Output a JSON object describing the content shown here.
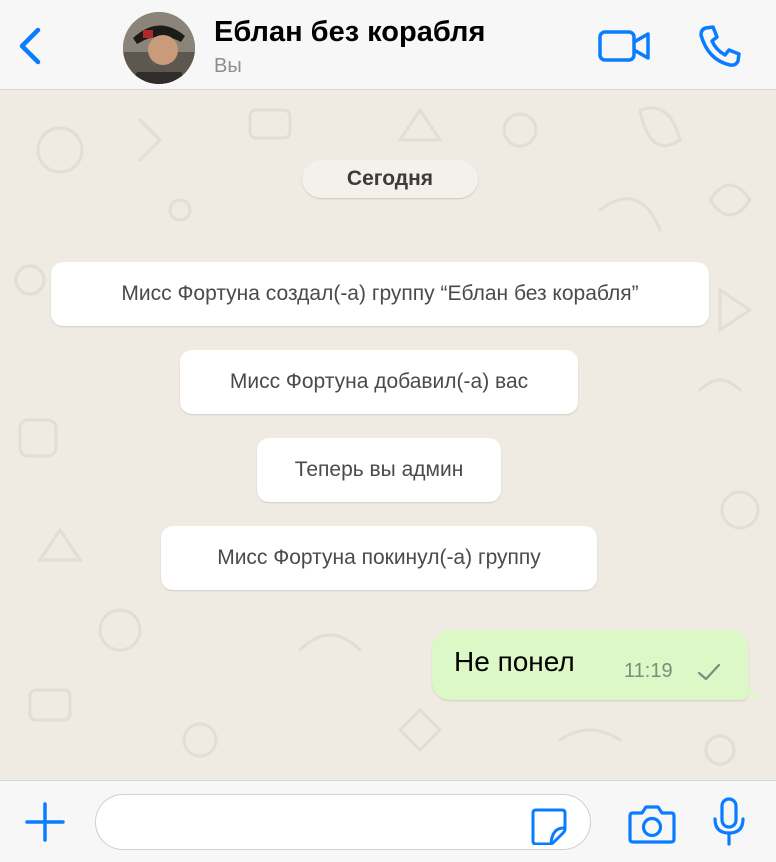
{
  "header": {
    "back_icon": "chevron-left-icon",
    "avatar_icon": "pirate-avatar",
    "title": "Еблан без корабля",
    "subtitle": "Вы",
    "video_icon": "video-camera-icon",
    "call_icon": "phone-icon"
  },
  "chat": {
    "date_label": "Сегодня",
    "system_messages": [
      "Мисс Фортуна создал(-а) группу “Еблан без корабля”",
      "Мисс Фортуна добавил(-а) вас",
      "Теперь вы админ",
      "Мисс Фортуна покинул(-а) группу"
    ],
    "outgoing_message": {
      "text": "Не понел",
      "time": "11:19",
      "status_icon": "single-check-icon"
    }
  },
  "composer": {
    "plus_icon": "plus-icon",
    "input_value": "",
    "sticker_icon": "sticker-icon",
    "camera_icon": "camera-icon",
    "mic_icon": "microphone-icon"
  },
  "colors": {
    "accent": "#0a7cff",
    "header_bg": "#f7f7f7",
    "chat_bg": "#efeae2",
    "outgoing_bubble": "#dcf8c6",
    "system_bubble": "#ffffff"
  }
}
